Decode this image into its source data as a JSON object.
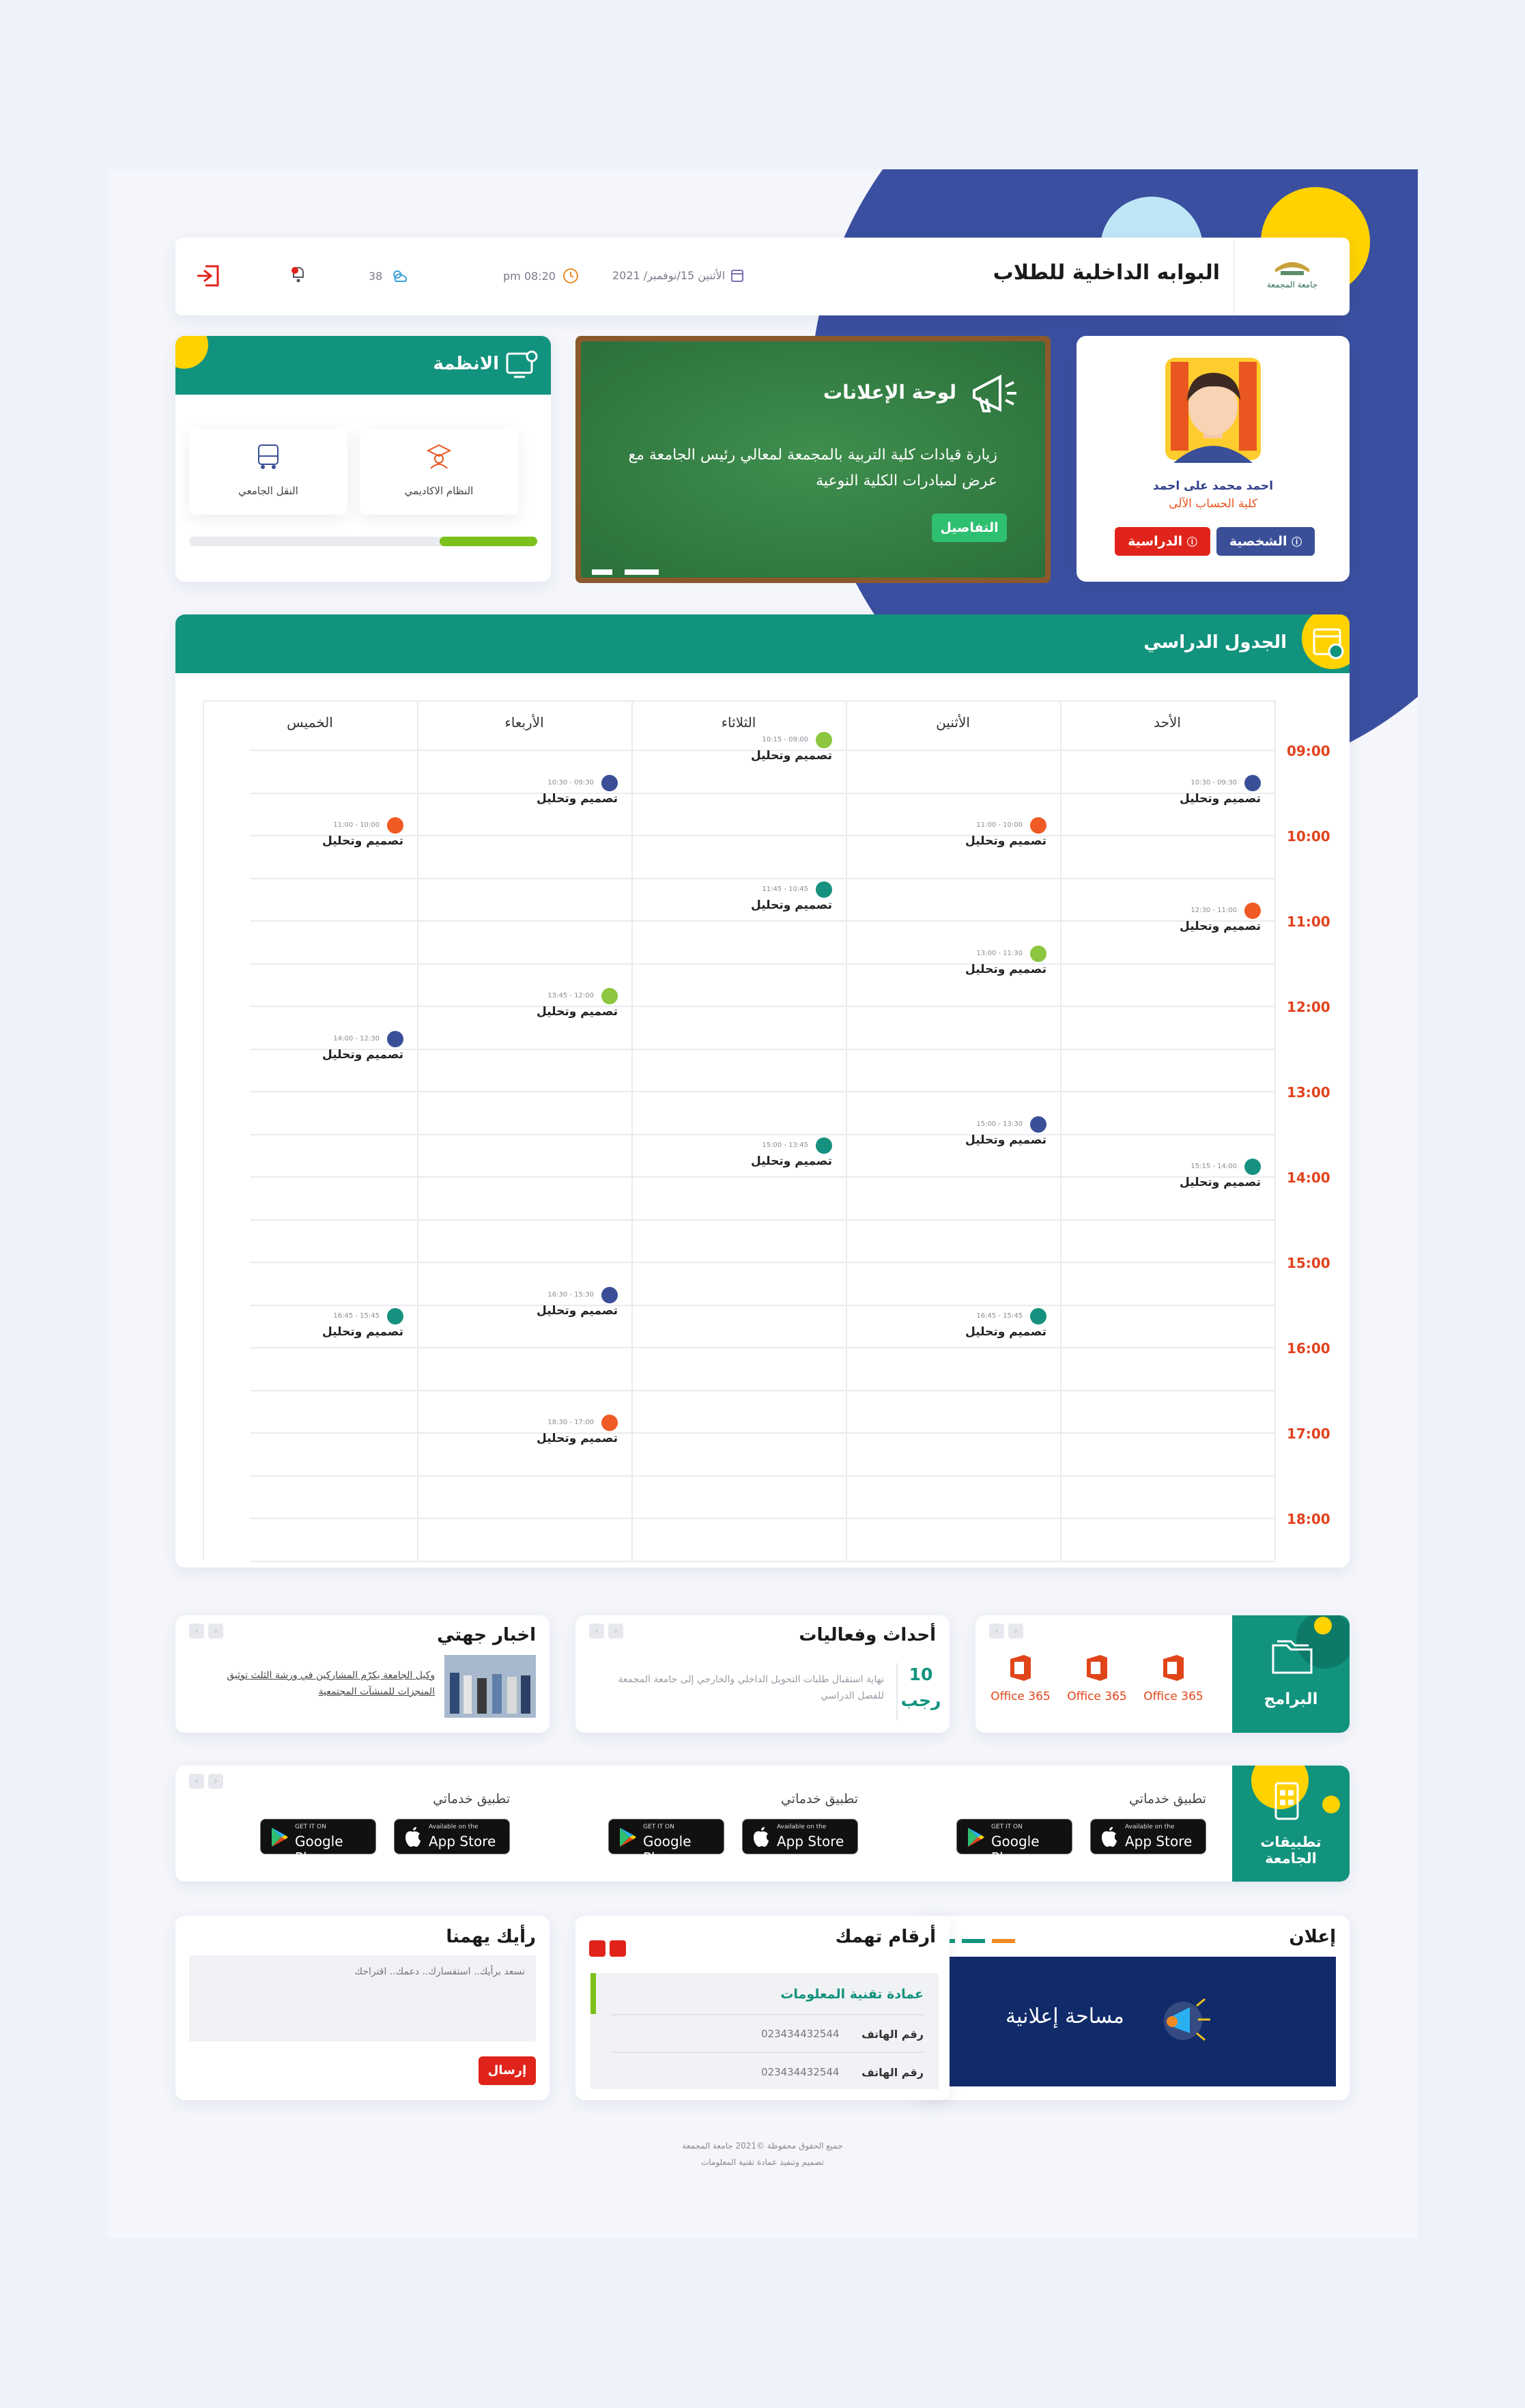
{
  "header": {
    "title": "البوابه الداخلية للطلاب",
    "logo_text": "جامعة المجمعة",
    "date": "الأثنين 15/نوفمبر/ 2021",
    "time": "pm 08:20",
    "temperature": "38",
    "icons": [
      "logout-icon",
      "bell-icon",
      "weather-icon",
      "clock-icon",
      "calendar-icon"
    ]
  },
  "profile": {
    "name": "احمد محمد على احمد",
    "college": "كلية الحساب الآلى",
    "btn_personal": "الشخصية",
    "btn_study": "الدراسية"
  },
  "announcements": {
    "title": "لوحة الإعلانات",
    "text": "زيارة قيادات كلية التربية بالمجمعة لمعالي رئيس الجامعة مع عرض لمبادرات الكلية النوعية",
    "details_btn": "التفاصيل",
    "slide_index": 1,
    "slide_count": 2
  },
  "systems": {
    "title": "الانظمة",
    "items": [
      {
        "label": "النظام الاكاديمي"
      },
      {
        "label": "النقل الجامعي"
      }
    ],
    "progress": 0.28
  },
  "schedule": {
    "title": "الجدول الدراسي",
    "days": [
      "الأحد",
      "الأثنين",
      "الثلاثاء",
      "الأربعاء",
      "الخميس"
    ],
    "hours": [
      "09:00",
      "10:00",
      "11:00",
      "12:00",
      "13:00",
      "14:00",
      "15:00",
      "16:00",
      "17:00",
      "18:00"
    ],
    "course": "تصميم وتحليل",
    "slots": [
      {
        "day": 2,
        "start": 9.0,
        "time": "09:00 - 10:15",
        "color": "#8dc63f"
      },
      {
        "day": 0,
        "start": 9.5,
        "time": "09:30 - 10:30",
        "color": "#3a4f98"
      },
      {
        "day": 3,
        "start": 9.5,
        "time": "09:30 - 10:30",
        "color": "#3a4f98"
      },
      {
        "day": 1,
        "start": 10.0,
        "time": "10:00 - 11:00",
        "color": "#f05a24"
      },
      {
        "day": 4,
        "start": 10.0,
        "time": "10:00 - 11:00",
        "color": "#f05a24"
      },
      {
        "day": 2,
        "start": 10.75,
        "time": "10:45 - 11:45",
        "color": "#16917f"
      },
      {
        "day": 0,
        "start": 11.0,
        "time": "11:00 - 12:30",
        "color": "#f05a24"
      },
      {
        "day": 1,
        "start": 11.5,
        "time": "11:30 - 13:00",
        "color": "#8dc63f"
      },
      {
        "day": 3,
        "start": 12.0,
        "time": "12:00 - 13:45",
        "color": "#8dc63f"
      },
      {
        "day": 4,
        "start": 12.5,
        "time": "12:30 - 14:00",
        "color": "#3a4f98"
      },
      {
        "day": 1,
        "start": 13.5,
        "time": "13:30 - 15:00",
        "color": "#3a4f98"
      },
      {
        "day": 2,
        "start": 13.75,
        "time": "13:45 - 15:00",
        "color": "#16917f"
      },
      {
        "day": 0,
        "start": 14.0,
        "time": "14:00 - 15:15",
        "color": "#16917f"
      },
      {
        "day": 3,
        "start": 15.5,
        "time": "15:30 - 16:30",
        "color": "#3a4f98"
      },
      {
        "day": 1,
        "start": 15.75,
        "time": "15:45 - 16:45",
        "color": "#16917f"
      },
      {
        "day": 4,
        "start": 15.75,
        "time": "15:45 - 16:45",
        "color": "#16917f"
      },
      {
        "day": 3,
        "start": 17.0,
        "time": "17:00 - 18:30",
        "color": "#f05a24"
      }
    ]
  },
  "programs": {
    "title": "البرامج",
    "items": [
      "Office 365",
      "Office 365",
      "Office 365"
    ]
  },
  "events": {
    "title": "أحداث وفعاليات",
    "day": "10",
    "month": "رجب",
    "text": "نهاية استقبال طلبات التحويل الداخلي والخارجي إلى جامعة المجمعة للفصل الدراسي"
  },
  "news": {
    "title": "اخبار جهتي",
    "text": "وكيل الجامعة يكرّم المشاركين في ورشة الثلث توثيق المنجزات للمنشآت المجتمعية"
  },
  "apps": {
    "title": "تطبيقات الجامعة",
    "groups": [
      {
        "label": "تطبيق خدماتي"
      },
      {
        "label": "تطبيق خدماتي"
      },
      {
        "label": "تطبيق خدماتي"
      }
    ],
    "google_small": "GET IT ON",
    "google_big": "Google Play",
    "apple_small": "Available on the",
    "apple_big": "App Store"
  },
  "ad": {
    "title": "إعلان",
    "banner": "مساحة إعلانية"
  },
  "numbers": {
    "title": "أرقام تهمك",
    "dept": "عمادة تقنية المعلومات",
    "phone_label": "رقم الهاتف",
    "phone": "023434432544"
  },
  "opinion": {
    "title": "رأيك يهمنا",
    "placeholder": "نسعد برأيك.. استفسارك.. دعمك.. اقتراحك",
    "send": "إرسال"
  },
  "footer": {
    "line1": "جميع الحقوق محفوظة ©2021 جامعة المجمعة",
    "line2": "تصميم وتنفيذ عمادة تقنية المعلومات"
  }
}
